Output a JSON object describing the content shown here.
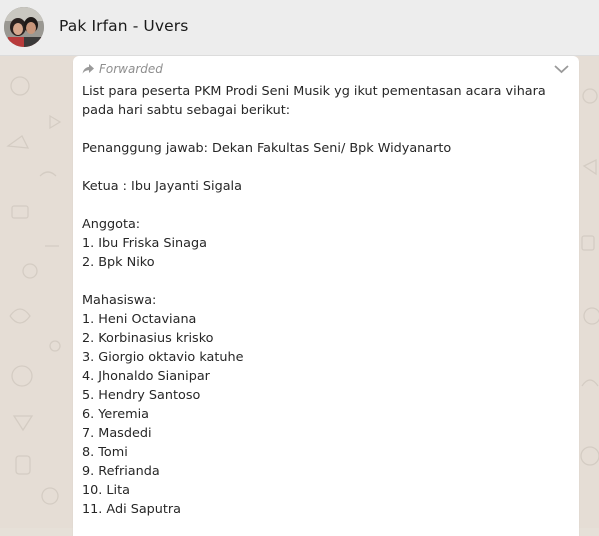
{
  "header": {
    "title": "Pak Irfan - Uvers",
    "avatar_icon": "profile-photo"
  },
  "message": {
    "forwarded_label": "Forwarded",
    "forward_icon": "forward-arrow-icon",
    "menu_icon": "chevron-down-icon",
    "lines": [
      "List para peserta PKM Prodi Seni Musik yg ikut pementasan acara vihara pada hari sabtu sebagai berikut:",
      "",
      "Penanggung jawab: Dekan Fakultas Seni/ Bpk Widyanarto",
      "",
      "Ketua : Ibu Jayanti Sigala",
      "",
      "Anggota:",
      "1. Ibu Friska Sinaga",
      "2. Bpk Niko",
      "",
      "Mahasiswa:",
      "1. Heni Octaviana",
      "2. Korbinasius krisko",
      "3. Giorgio oktavio katuhe",
      "4. Jhonaldo Sianipar",
      "5. Hendry Santoso",
      "6. Yeremia",
      "7. Masdedi",
      "8. Tomi",
      "9. Refrianda",
      "10. Lita",
      "11. Adi Saputra"
    ]
  }
}
